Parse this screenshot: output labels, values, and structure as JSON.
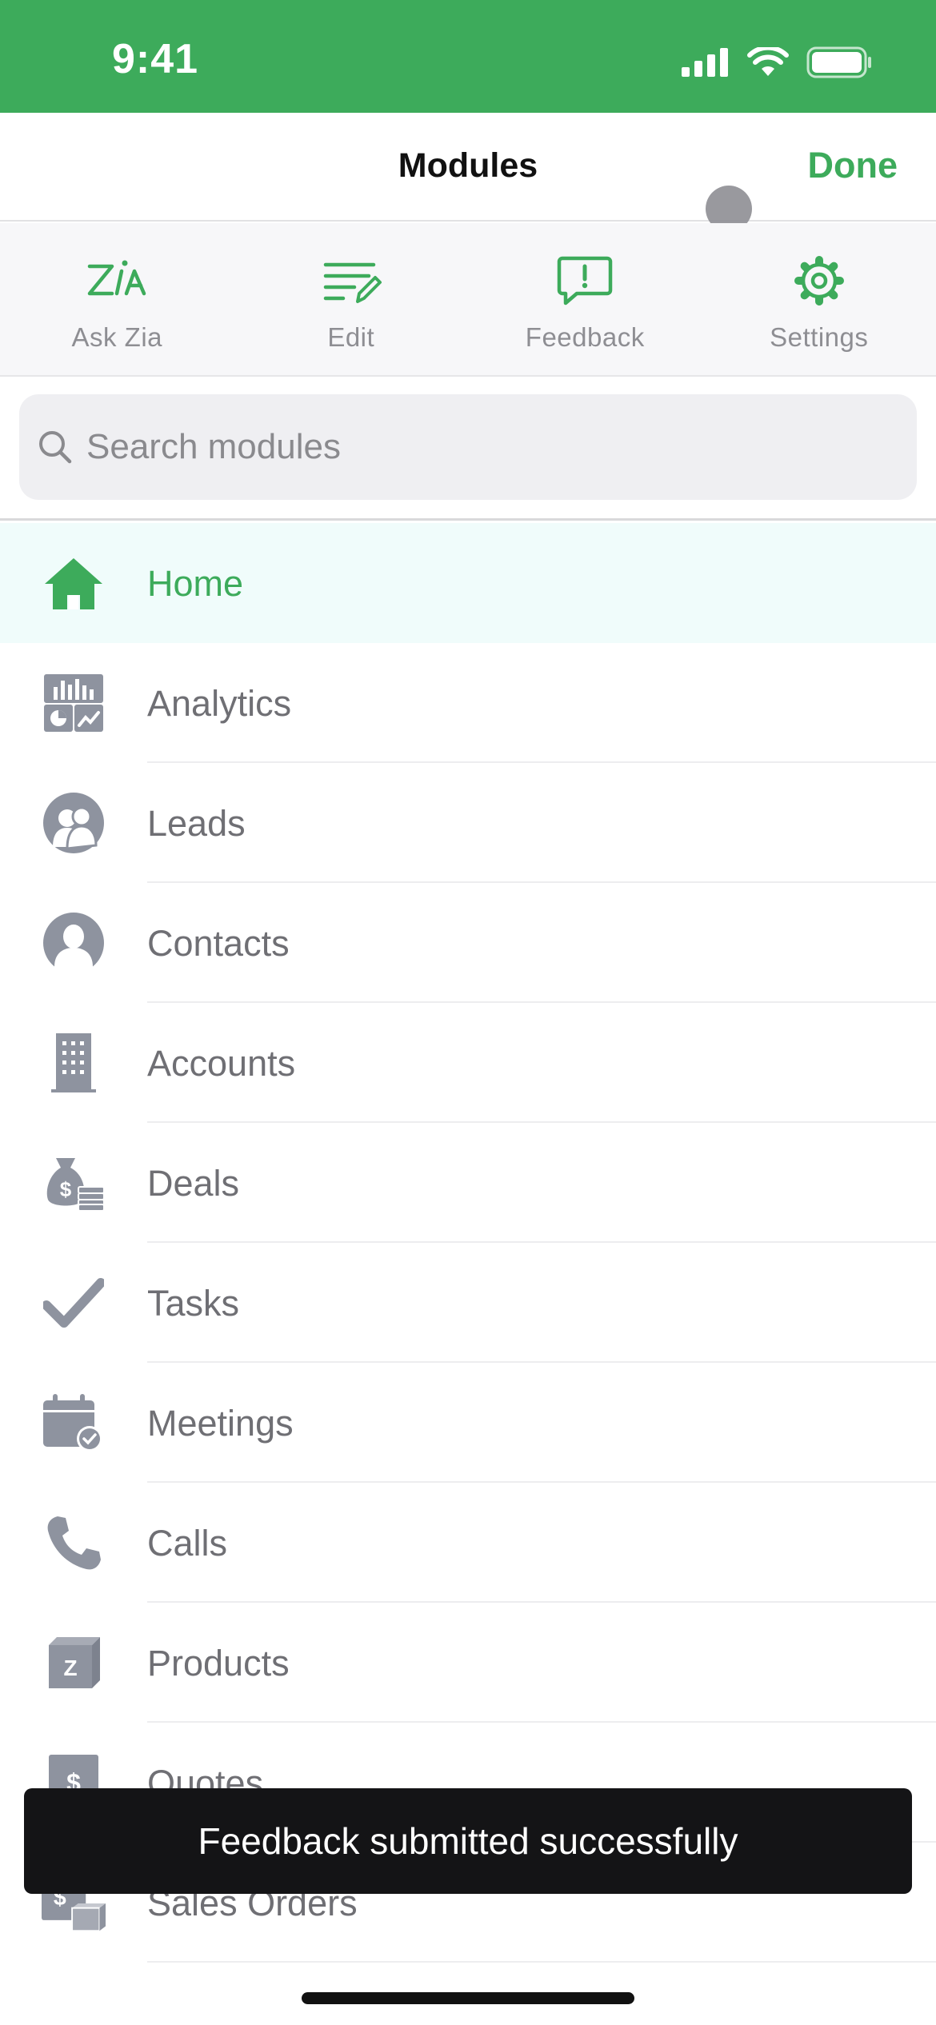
{
  "status_bar": {
    "time": "9:41"
  },
  "nav": {
    "title": "Modules",
    "done_label": "Done"
  },
  "toolbar": [
    {
      "label": "Ask Zia",
      "icon": "zia-icon"
    },
    {
      "label": "Edit",
      "icon": "edit-list-icon"
    },
    {
      "label": "Feedback",
      "icon": "feedback-icon"
    },
    {
      "label": "Settings",
      "icon": "gear-icon"
    }
  ],
  "search": {
    "placeholder": "Search modules"
  },
  "modules": [
    {
      "label": "Home",
      "icon": "home-icon",
      "active": true
    },
    {
      "label": "Analytics",
      "icon": "analytics-icon"
    },
    {
      "label": "Leads",
      "icon": "leads-icon"
    },
    {
      "label": "Contacts",
      "icon": "contact-icon"
    },
    {
      "label": "Accounts",
      "icon": "building-icon"
    },
    {
      "label": "Deals",
      "icon": "money-bag-icon"
    },
    {
      "label": "Tasks",
      "icon": "checkmark-icon"
    },
    {
      "label": "Meetings",
      "icon": "calendar-icon"
    },
    {
      "label": "Calls",
      "icon": "phone-icon"
    },
    {
      "label": "Products",
      "icon": "product-box-icon"
    },
    {
      "label": "Quotes",
      "icon": "quote-icon"
    },
    {
      "label": "Sales Orders",
      "icon": "sales-order-icon"
    }
  ],
  "toast": {
    "message": "Feedback submitted successfully"
  },
  "colors": {
    "accent": "#3dab5b",
    "icon_gray": "#8e939f",
    "active_row": "#f0fcfb"
  }
}
